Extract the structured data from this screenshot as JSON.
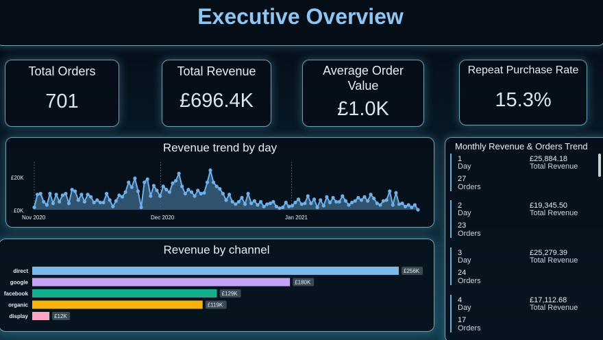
{
  "header": {
    "title": "Executive Overview"
  },
  "kpis": {
    "total_orders": {
      "label": "Total Orders",
      "value": "701"
    },
    "total_revenue": {
      "label": "Total Revenue",
      "value": "£696.4K"
    },
    "average_order_value": {
      "label_line1": "Average Order",
      "label_line2": "Value",
      "value": "£1.0K"
    },
    "repeat_purchase_rate": {
      "label": "Repeat Purchase Rate",
      "value": "15.3%"
    }
  },
  "trend": {
    "title": "Revenue trend by day",
    "y_ticks": [
      "£20K",
      "£0K"
    ],
    "x_ticks": [
      "Nov 2020",
      "Dec 2020",
      "Jan 2021"
    ]
  },
  "channel": {
    "title": "Revenue by channel"
  },
  "monthly": {
    "title": "Monthly Revenue & Orders Trend",
    "day_label": "Day",
    "orders_label": "Orders",
    "revenue_label": "Total Revenue",
    "items": [
      {
        "day": "1",
        "revenue": "£25,884.18",
        "orders": "27"
      },
      {
        "day": "2",
        "revenue": "£19,345.50",
        "orders": "23"
      },
      {
        "day": "3",
        "revenue": "£25,279.39",
        "orders": "24"
      },
      {
        "day": "4",
        "revenue": "£17,112.68",
        "orders": "17"
      }
    ]
  },
  "chart_data": [
    {
      "type": "area",
      "title": "Revenue trend by day",
      "xlabel": "",
      "ylabel": "",
      "x_range": [
        "2020-11-01",
        "2021-01-31"
      ],
      "ylim": [
        0,
        25000
      ],
      "ytick_labels": [
        "£0K",
        "£20K"
      ],
      "xtick_labels": [
        "Nov 2020",
        "Dec 2020",
        "Jan 2021"
      ],
      "color": "#6fb0e8",
      "values": [
        1500,
        9500,
        10000,
        5000,
        3000,
        10000,
        4000,
        9500,
        5000,
        9000,
        10000,
        4000,
        12500,
        11500,
        6000,
        9500,
        5000,
        9500,
        8000,
        4500,
        6000,
        4500,
        4500,
        10000,
        6000,
        2000,
        5500,
        9000,
        8000,
        11000,
        17000,
        14000,
        19500,
        11500,
        1500,
        17000,
        19000,
        8500,
        15000,
        12000,
        8500,
        14500,
        12500,
        11000,
        16500,
        18000,
        22500,
        14500,
        10000,
        12500,
        11000,
        8500,
        12000,
        10000,
        10500,
        17000,
        24500,
        17000,
        14500,
        13000,
        10000,
        6000,
        9500,
        5000,
        3500,
        5000,
        7500,
        3500,
        10000,
        4000,
        5500,
        3000,
        5000,
        2000,
        3500,
        4000,
        5000,
        2000,
        1000,
        1500,
        4500,
        2000,
        2500,
        4500,
        6500,
        3500,
        4000,
        8500,
        4000,
        6500,
        1500,
        6000,
        2500,
        8000,
        4500,
        7500,
        5000,
        5000,
        8500,
        5500,
        3000,
        4500,
        5500,
        7500,
        6000,
        8000,
        5500,
        9500,
        7000,
        4000,
        3000,
        5500,
        6000,
        11500,
        3000,
        10500,
        3500,
        4000,
        2000,
        3000,
        1500,
        3000,
        0
      ]
    },
    {
      "type": "bar",
      "orientation": "horizontal",
      "title": "Revenue by channel",
      "xlabel": "",
      "ylabel": "",
      "categories": [
        "direct",
        "google",
        "facebook",
        "organic",
        "display"
      ],
      "values": [
        256000,
        180000,
        129000,
        119000,
        12000
      ],
      "value_labels": [
        "£256K",
        "£180K",
        "£129K",
        "£119K",
        "£12K"
      ],
      "colors": [
        "#7ab8ea",
        "#c2a3f5",
        "#14b08c",
        "#f8b30e",
        "#f7a5c4"
      ],
      "grid": false
    }
  ]
}
